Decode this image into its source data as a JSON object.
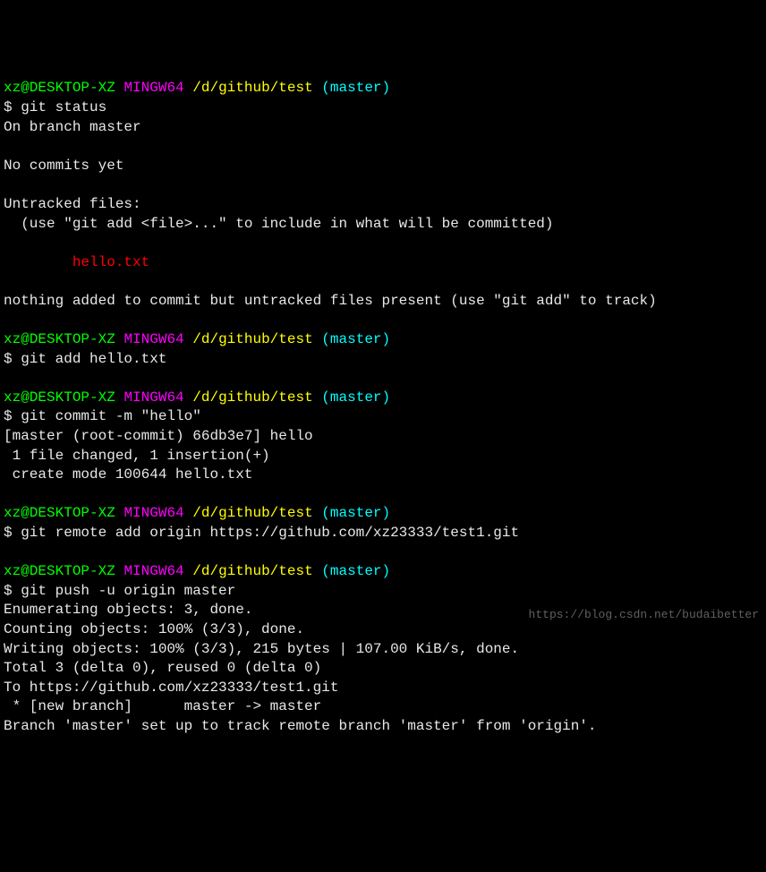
{
  "prompt": {
    "userhost": "xz@DESKTOP-XZ",
    "shell": "MINGW64",
    "path": "/d/github/test",
    "branch_open": "(",
    "branch": "master",
    "branch_close": ")"
  },
  "dollar": "$ ",
  "commands": {
    "status": "git status",
    "add": "git add hello.txt",
    "commit": "git commit -m \"hello\"",
    "remote": "git remote add origin https://github.com/xz23333/test1.git",
    "push": "git push -u origin master"
  },
  "status_output": {
    "on_branch": "On branch master",
    "no_commits": "No commits yet",
    "untracked_header": "Untracked files:",
    "untracked_hint": "  (use \"git add <file>...\" to include in what will be committed)",
    "untracked_file": "        hello.txt",
    "nothing_added": "nothing added to commit but untracked files present (use \"git add\" to track)"
  },
  "commit_output": {
    "l1": "[master (root-commit) 66db3e7] hello",
    "l2": " 1 file changed, 1 insertion(+)",
    "l3": " create mode 100644 hello.txt"
  },
  "push_output": {
    "l1": "Enumerating objects: 3, done.",
    "l2": "Counting objects: 100% (3/3), done.",
    "l3": "Writing objects: 100% (3/3), 215 bytes | 107.00 KiB/s, done.",
    "l4": "Total 3 (delta 0), reused 0 (delta 0)",
    "l5": "To https://github.com/xz23333/test1.git",
    "l6": " * [new branch]      master -> master",
    "l7": "Branch 'master' set up to track remote branch 'master' from 'origin'."
  },
  "watermark": "https://blog.csdn.net/budaibetter"
}
